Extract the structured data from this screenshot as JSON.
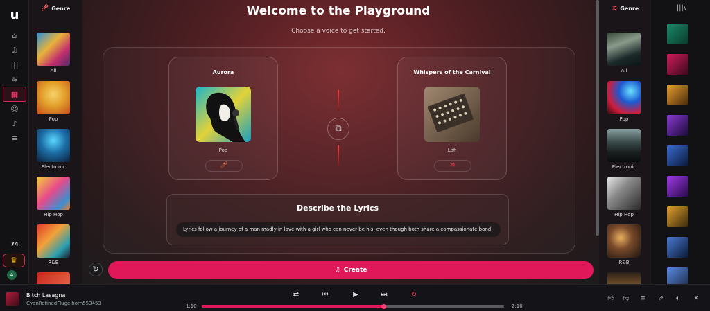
{
  "left_genres": {
    "header": "Genre",
    "items": [
      {
        "label": "All"
      },
      {
        "label": "Pop"
      },
      {
        "label": "Electronic"
      },
      {
        "label": "Hip Hop"
      },
      {
        "label": "R&B"
      }
    ]
  },
  "right_genres": {
    "header": "Genre",
    "items": [
      {
        "label": "All"
      },
      {
        "label": "Pop"
      },
      {
        "label": "Electronic"
      },
      {
        "label": "Hip Hop"
      },
      {
        "label": "R&B"
      }
    ]
  },
  "rail": {
    "credits": "74",
    "avatar_initial": "A"
  },
  "main": {
    "title": "Welcome to the Playground",
    "subtitle": "Choose a voice to get started.",
    "voice_left": {
      "name": "Aurora",
      "genre": "Pop"
    },
    "voice_right": {
      "name": "Whispers of the Carnival",
      "genre": "Lofi"
    },
    "lyrics_title": "Describe the Lyrics",
    "lyrics_value": "Lyrics follow a journey of a man madly in love with a girl who can never be his, even though both share a compassionate bond",
    "create_label": "Create"
  },
  "player": {
    "title": "Bitch Lasagna",
    "artist": "CyanRefinedFlugelhorn553453",
    "time_current": "1:10",
    "time_total": "2:10",
    "progress": 0.6
  },
  "colors": {
    "accent": "#e0185a",
    "crown": "#f2b705"
  }
}
